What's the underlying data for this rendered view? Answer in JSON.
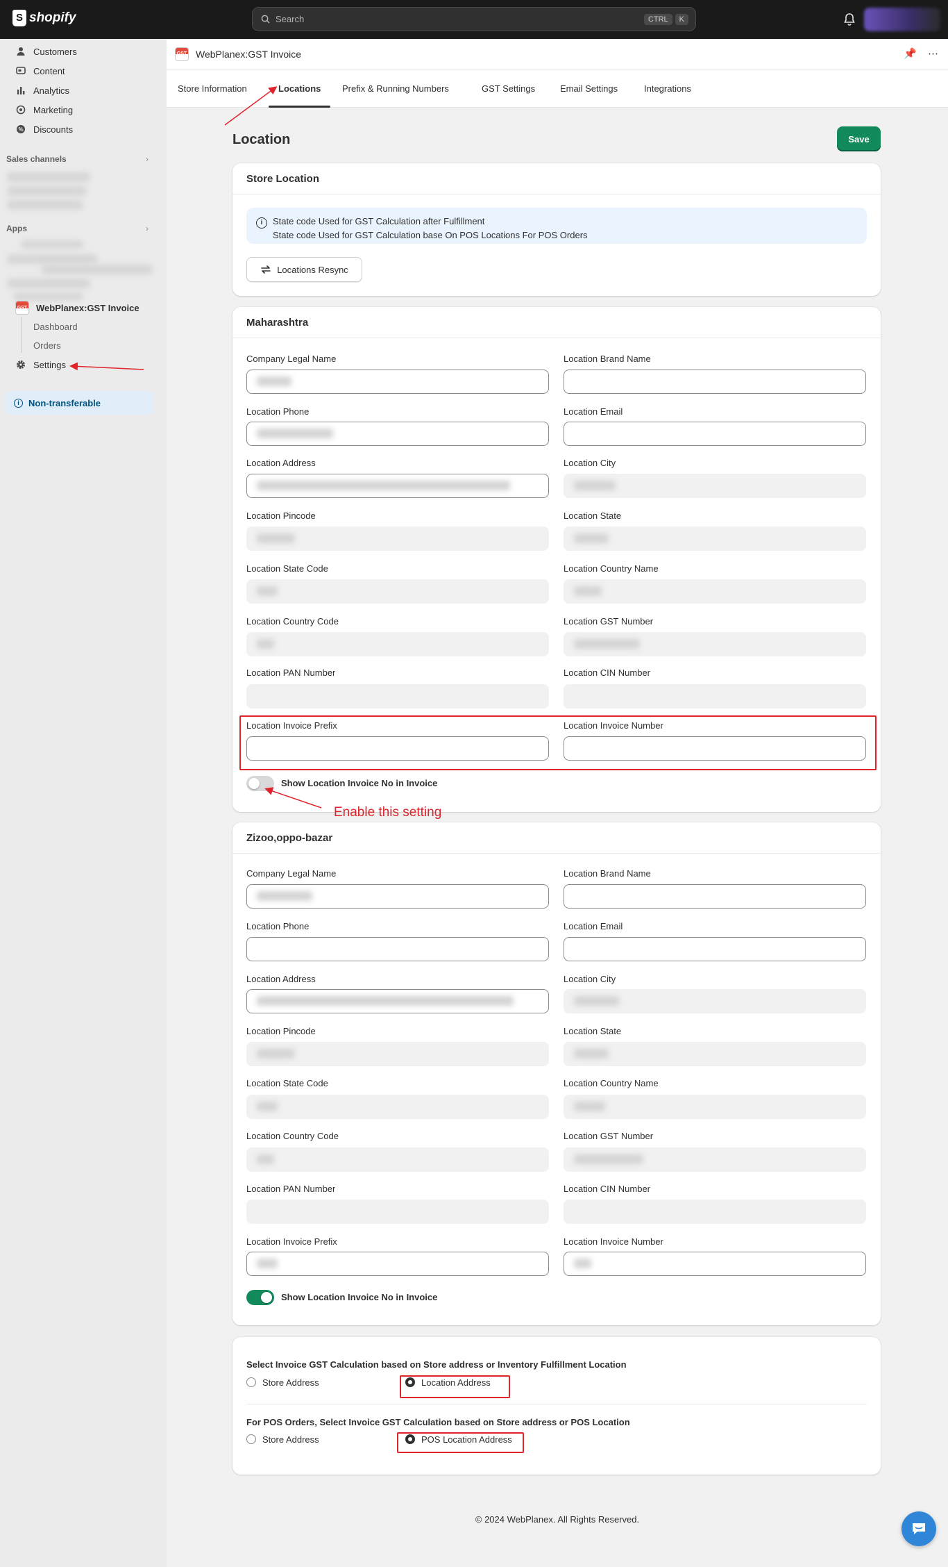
{
  "topbar": {
    "brand": "shopify",
    "search_placeholder": "Search",
    "shortcut_keys": [
      "CTRL",
      "K"
    ]
  },
  "sidebar": {
    "items": [
      {
        "label": "Customers",
        "icon": "person-icon"
      },
      {
        "label": "Content",
        "icon": "content-icon"
      },
      {
        "label": "Analytics",
        "icon": "bar-chart-icon"
      },
      {
        "label": "Marketing",
        "icon": "target-icon"
      },
      {
        "label": "Discounts",
        "icon": "discount-icon"
      }
    ],
    "sales_channels_label": "Sales channels",
    "apps_label": "Apps",
    "app_name": "WebPlanex:GST Invoice",
    "app_sub_items": [
      "Dashboard",
      "Orders"
    ],
    "settings_label": "Settings",
    "non_transferable_label": "Non-transferable"
  },
  "app_header": {
    "title": "WebPlanex:GST Invoice",
    "icon_text": "GST"
  },
  "tabs": [
    "Store Information",
    "Locations",
    "Prefix & Running Numbers",
    "GST Settings",
    "Email Settings",
    "Integrations"
  ],
  "active_tab": "Locations",
  "page": {
    "title": "Location",
    "save_label": "Save"
  },
  "store_location": {
    "title": "Store Location",
    "banner_lines": [
      "State code Used for GST Calculation after Fulfillment",
      "State code Used for GST Calculation base On POS Locations For POS Orders"
    ],
    "resync_label": "Locations Resync"
  },
  "field_labels": {
    "company_legal_name": "Company Legal Name",
    "location_brand_name": "Location Brand Name",
    "location_phone": "Location Phone",
    "location_email": "Location Email",
    "location_address": "Location Address",
    "location_city": "Location City",
    "location_pincode": "Location Pincode",
    "location_state": "Location State",
    "location_state_code": "Location State Code",
    "location_country_name": "Location Country Name",
    "location_country_code": "Location Country Code",
    "location_gst_number": "Location GST Number",
    "location_pan_number": "Location PAN Number",
    "location_cin_number": "Location CIN Number",
    "location_invoice_prefix": "Location Invoice Prefix",
    "location_invoice_number": "Location Invoice Number"
  },
  "locations": [
    {
      "name": "Maharashtra",
      "toggle_label": "Show Location Invoice No in Invoice",
      "toggle_on": false
    },
    {
      "name": "Zizoo,oppo-bazar",
      "toggle_label": "Show Location Invoice No in Invoice",
      "toggle_on": true
    }
  ],
  "gst_calc": {
    "q1": "Select Invoice GST Calculation based on Store address or Inventory Fulfillment Location",
    "q1_options": [
      "Store Address",
      "Location Address"
    ],
    "q1_selected": "Location Address",
    "q2": "For POS Orders, Select Invoice GST Calculation based on Store address or POS Location",
    "q2_options": [
      "Store Address",
      "POS Location Address"
    ],
    "q2_selected": "POS Location Address"
  },
  "annotation": "Enable this setting",
  "footer": "© 2024 WebPlanex. All Rights Reserved.",
  "colors": {
    "primary": "#128a5c",
    "annotation_red": "#e0242b",
    "topbar": "#1a1a1a",
    "banner": "#eaf4ff"
  }
}
